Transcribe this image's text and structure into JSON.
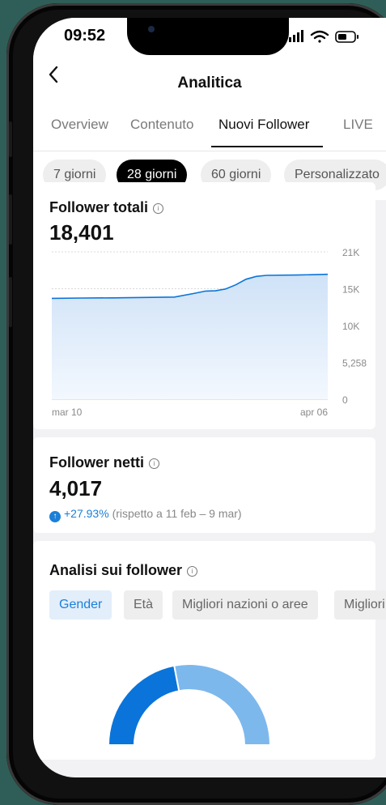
{
  "status_bar": {
    "time": "09:52"
  },
  "nav": {
    "title": "Analitica",
    "back_icon": "chevron-left-icon"
  },
  "tabs": [
    {
      "label": "Overview",
      "active": false
    },
    {
      "label": "Contenuto",
      "active": false
    },
    {
      "label": "Nuovi Follower",
      "active": true
    },
    {
      "label": "LIVE",
      "active": false
    }
  ],
  "date_ranges": [
    {
      "label": "7 giorni",
      "active": false
    },
    {
      "label": "28 giorni",
      "active": true
    },
    {
      "label": "60 giorni",
      "active": false
    },
    {
      "label": "Personalizzato",
      "active": false
    }
  ],
  "total_followers": {
    "title": "Follower totali",
    "value": "18,401"
  },
  "net_followers": {
    "title": "Follower netti",
    "value": "4,017",
    "change": "+27.93%",
    "comparison": "(rispetto a 11 feb – 9 mar)"
  },
  "follower_insights": {
    "title": "Analisi sui follower",
    "tabs": [
      {
        "label": "Gender",
        "active": true
      },
      {
        "label": "Età",
        "active": false
      },
      {
        "label": "Migliori nazioni o aree",
        "active": false
      },
      {
        "label": "Migliori città",
        "active": false
      }
    ],
    "gender_split": [
      {
        "share": 0.44,
        "color": "#0a74da"
      },
      {
        "share": 0.56,
        "color": "#7db8ec"
      }
    ]
  },
  "chart_data": {
    "type": "area",
    "x_labels": [
      "mar 10",
      "apr 06"
    ],
    "y_ticks": [
      "21K",
      "15K",
      "10K",
      "5,258",
      "0"
    ],
    "ylim": [
      0,
      21000
    ],
    "x": [
      0,
      3,
      6,
      9,
      12,
      14,
      15,
      16,
      17,
      18,
      19,
      20,
      21,
      24,
      27
    ],
    "y": [
      14380,
      14420,
      14450,
      14500,
      14560,
      15100,
      15400,
      15450,
      15700,
      16300,
      17100,
      17500,
      17650,
      17700,
      17800
    ],
    "color": "#0a74da",
    "grid": true
  }
}
